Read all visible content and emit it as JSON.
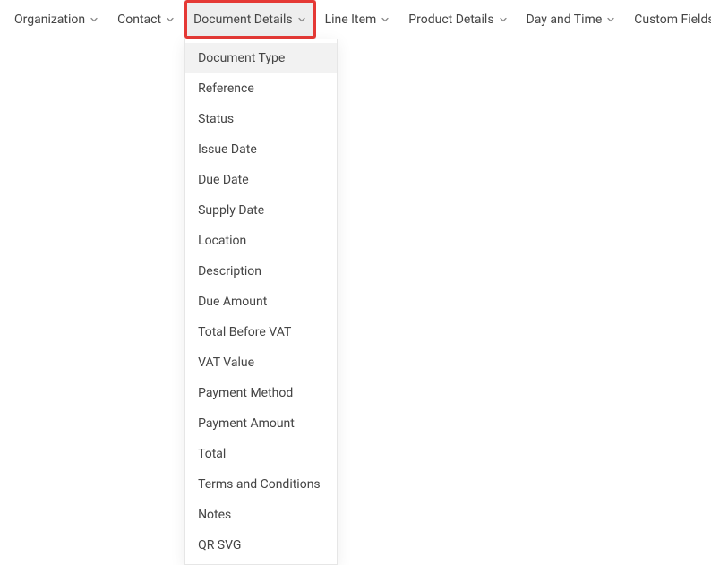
{
  "toolbar": {
    "menus": [
      {
        "label": "Organization",
        "name": "menu-organization"
      },
      {
        "label": "Contact",
        "name": "menu-contact"
      },
      {
        "label": "Document Details",
        "name": "menu-document-details",
        "active": true,
        "highlighted": true
      },
      {
        "label": "Line Item",
        "name": "menu-line-item"
      },
      {
        "label": "Product Details",
        "name": "menu-product-details"
      },
      {
        "label": "Day and Time",
        "name": "menu-day-and-time"
      },
      {
        "label": "Custom Fields",
        "name": "menu-custom-fields"
      }
    ]
  },
  "documentDetailsDropdown": {
    "items": [
      {
        "label": "Document Type",
        "name": "dropdown-document-type",
        "hover": true
      },
      {
        "label": "Reference",
        "name": "dropdown-reference"
      },
      {
        "label": "Status",
        "name": "dropdown-status"
      },
      {
        "label": "Issue Date",
        "name": "dropdown-issue-date"
      },
      {
        "label": "Due Date",
        "name": "dropdown-due-date"
      },
      {
        "label": "Supply Date",
        "name": "dropdown-supply-date"
      },
      {
        "label": "Location",
        "name": "dropdown-location"
      },
      {
        "label": "Description",
        "name": "dropdown-description"
      },
      {
        "label": "Due Amount",
        "name": "dropdown-due-amount"
      },
      {
        "label": "Total Before VAT",
        "name": "dropdown-total-before-vat"
      },
      {
        "label": "VAT Value",
        "name": "dropdown-vat-value"
      },
      {
        "label": "Payment Method",
        "name": "dropdown-payment-method"
      },
      {
        "label": "Payment Amount",
        "name": "dropdown-payment-amount"
      },
      {
        "label": "Total",
        "name": "dropdown-total"
      },
      {
        "label": "Terms and Conditions",
        "name": "dropdown-terms-and-conditions"
      },
      {
        "label": "Notes",
        "name": "dropdown-notes"
      },
      {
        "label": "QR SVG",
        "name": "dropdown-qr-svg"
      }
    ]
  }
}
